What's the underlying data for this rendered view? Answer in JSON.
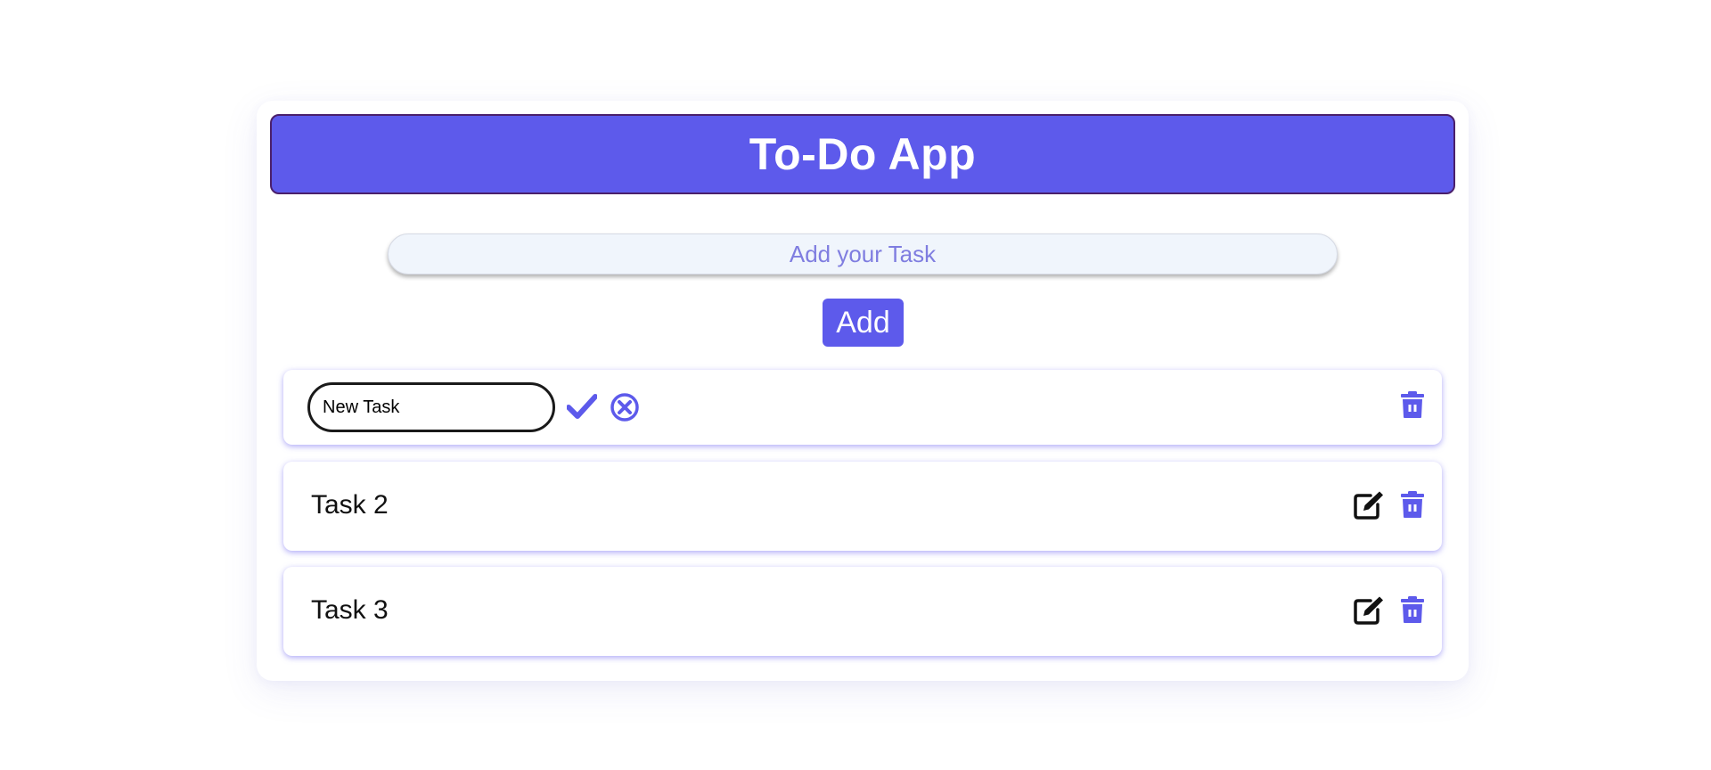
{
  "app": {
    "title": "To-Do App"
  },
  "new_task": {
    "placeholder": "Add your Task",
    "value": ""
  },
  "add_button": {
    "label": "Add"
  },
  "tasks": [
    {
      "state": "editing",
      "edit_value": "New Task",
      "icons": [
        "check-icon",
        "cancel-icon",
        "trash-icon"
      ]
    },
    {
      "state": "view",
      "label": "Task 2",
      "icons": [
        "edit-icon",
        "trash-icon"
      ]
    },
    {
      "state": "view",
      "label": "Task 3",
      "icons": [
        "edit-icon",
        "trash-icon"
      ]
    }
  ],
  "colors": {
    "accent": "#5d5aeb",
    "header_border": "#4a1f6b",
    "input_bg": "#f0f5fc",
    "placeholder": "#7f7de0",
    "icon_dark": "#111111"
  }
}
